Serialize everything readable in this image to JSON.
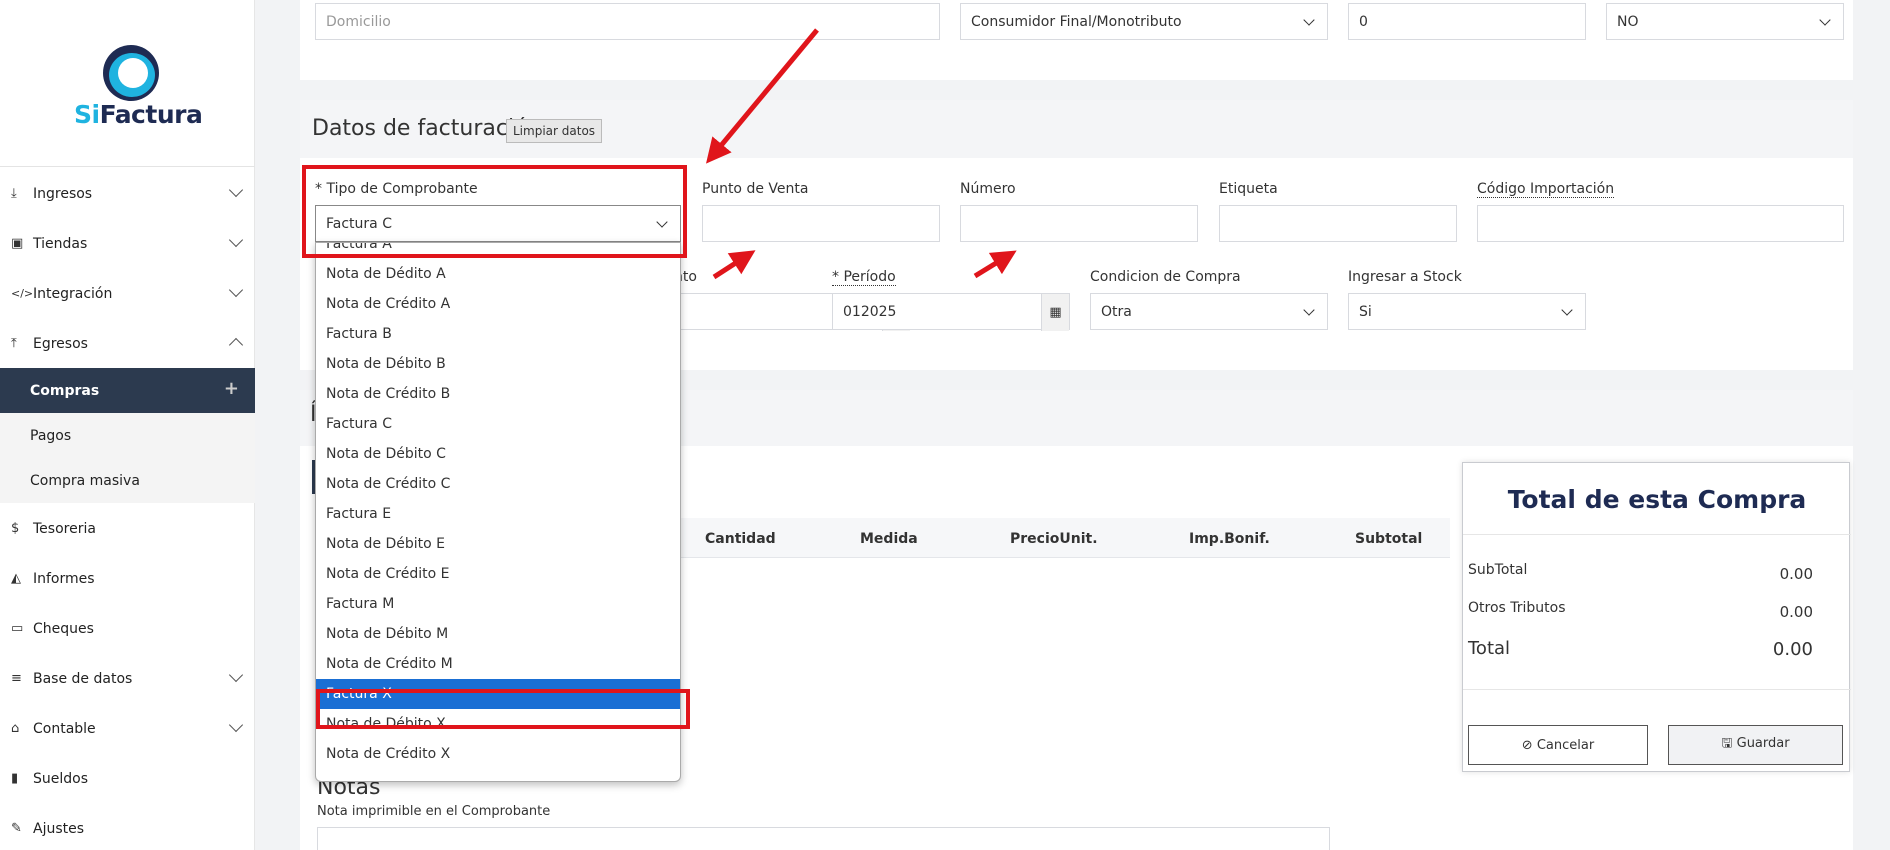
{
  "sidebar": {
    "logo": {
      "si": "Si",
      "factura": "Factura"
    },
    "items": [
      {
        "label": "Ingresos",
        "icon": "download-icon",
        "glyph": "⤓",
        "expandable": true
      },
      {
        "label": "Tiendas",
        "icon": "shop-icon",
        "glyph": "▣",
        "expandable": true
      },
      {
        "label": "Integración",
        "icon": "code-icon",
        "glyph": "</>",
        "expandable": true
      },
      {
        "label": "Egresos",
        "icon": "upload-icon",
        "glyph": "⤒",
        "expandable": true,
        "expanded": true
      },
      {
        "label": "Tesoreria",
        "icon": "dollar-icon",
        "glyph": "$",
        "expandable": false
      },
      {
        "label": "Informes",
        "icon": "area-chart-icon",
        "glyph": "◭",
        "expandable": false
      },
      {
        "label": "Cheques",
        "icon": "credit-card-icon",
        "glyph": "▭",
        "expandable": false
      },
      {
        "label": "Base de datos",
        "icon": "database-icon",
        "glyph": "≡",
        "expandable": true
      },
      {
        "label": "Contable",
        "icon": "bank-icon",
        "glyph": "⌂",
        "expandable": true
      },
      {
        "label": "Sueldos",
        "icon": "book-icon",
        "glyph": "▮",
        "expandable": false
      },
      {
        "label": "Ajustes",
        "icon": "wrench-icon",
        "glyph": "✎",
        "expandable": false
      }
    ],
    "submenu": [
      {
        "label": "Compras",
        "active": true
      },
      {
        "label": "Pagos",
        "active": false
      },
      {
        "label": "Compra masiva",
        "active": false
      }
    ],
    "plus_glyph": "+"
  },
  "top_row": {
    "domicilio_placeholder": "Domicilio",
    "condicion_value": "Consumidor Final/Monotributo",
    "number_value": "0",
    "no_value": "NO"
  },
  "facturacion": {
    "title": "Datos de facturación",
    "clear_button": "Limpiar datos",
    "labels": {
      "tipo": "* Tipo de Comprobante",
      "punto": "Punto de Venta",
      "numero": "Número",
      "etiqueta": "Etiqueta",
      "codigo": "Código Importación",
      "vencimiento_partial": "nto",
      "periodo": "* Período",
      "condicion_compra": "Condicion de Compra",
      "stock": "Ingresar a Stock"
    },
    "values": {
      "tipo": "Factura C",
      "periodo": "012025",
      "condicion_compra": "Otra",
      "stock": "Si"
    },
    "grid_glyph": "▦"
  },
  "items_section": {
    "title_partial": "Í",
    "headers": [
      "Cantidad",
      "Medida",
      "PrecioUnit.",
      "Imp.Bonif.",
      "Subtotal"
    ]
  },
  "dropdown": {
    "options": [
      "Factura A",
      "Nota de Dédito A",
      "Nota de Crédito A",
      "Factura B",
      "Nota de Débito B",
      "Nota de Crédito B",
      "Factura C",
      "Nota de Débito C",
      "Nota de Crédito C",
      "Factura E",
      "Nota de Débito E",
      "Nota de Crédito E",
      "Factura M",
      "Nota de Débito M",
      "Nota de Crédito M",
      "Factura X",
      "Nota de Débito X",
      "Nota de Crédito X"
    ],
    "selected": "Factura X"
  },
  "notas": {
    "title": "Notas",
    "label": "Nota imprimible en el Comprobante"
  },
  "totals": {
    "title": "Total de esta Compra",
    "subtotal_label": "SubTotal",
    "subtotal_value": "0.00",
    "otros_label": "Otros Tributos",
    "otros_value": "0.00",
    "total_label": "Total",
    "total_value": "0.00",
    "cancel_button": "⊘ Cancelar",
    "save_button": "🖫 Guardar"
  },
  "colors": {
    "annotation": "#e0151b",
    "selected_option": "#1a6fd4",
    "sidebar_active": "#2c3a4f",
    "brand_dark": "#1e2b53",
    "brand_light": "#1fb3e0"
  }
}
